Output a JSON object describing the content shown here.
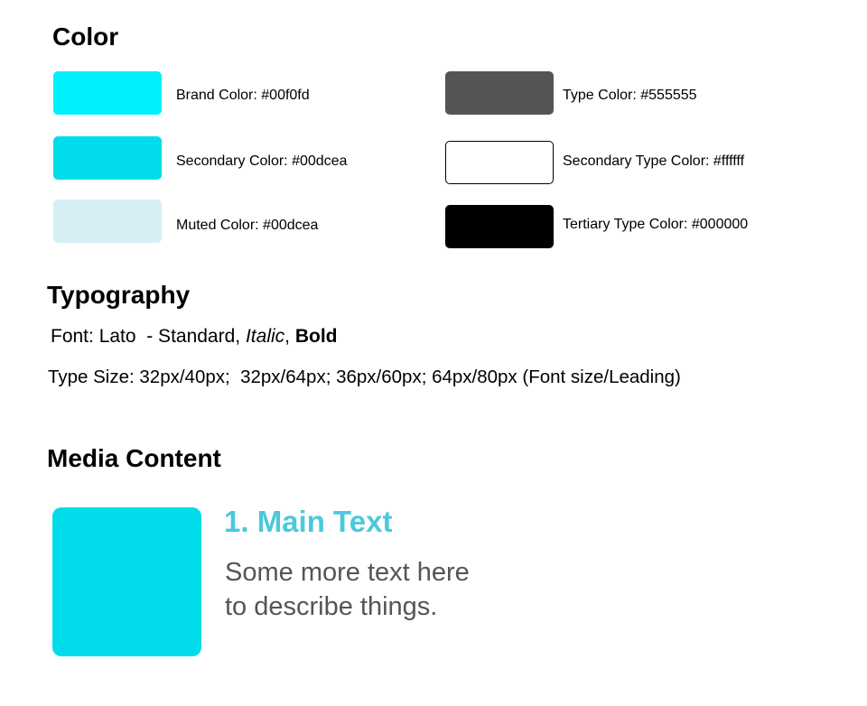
{
  "color_section": {
    "heading": "Color",
    "swatches": [
      {
        "label": "Brand Color: #00f0fd",
        "color": "#00f0fd",
        "border": "none"
      },
      {
        "label": "Secondary Color: #00dcea",
        "color": "#00dcea",
        "border": "none"
      },
      {
        "label": "Muted Color: #00dcea",
        "color": "#d5eff4",
        "border": "none"
      },
      {
        "label": "Type Color: #555555",
        "color": "#555555",
        "border": "none"
      },
      {
        "label": "Secondary Type Color: #ffffff",
        "color": "#ffffff",
        "border": "#000000"
      },
      {
        "label": "Tertiary Type Color: #000000",
        "color": "#000000",
        "border": "none"
      }
    ]
  },
  "typography_section": {
    "heading": "Typography",
    "font_prefix": "Font: Lato  - Standard, ",
    "font_italic": "Italic",
    "font_separator": ", ",
    "font_bold": "Bold",
    "type_size": "Type Size: 32px/40px;  32px/64px; 36px/60px; 64px/80px (Font size/Leading)"
  },
  "media_section": {
    "heading": "Media Content",
    "box_color": "#00dcea",
    "title": "1. Main Text",
    "title_color": "#4cc8dc",
    "description_line1": "Some more text here",
    "description_line2": "to describe things.",
    "description_color": "#555555"
  }
}
